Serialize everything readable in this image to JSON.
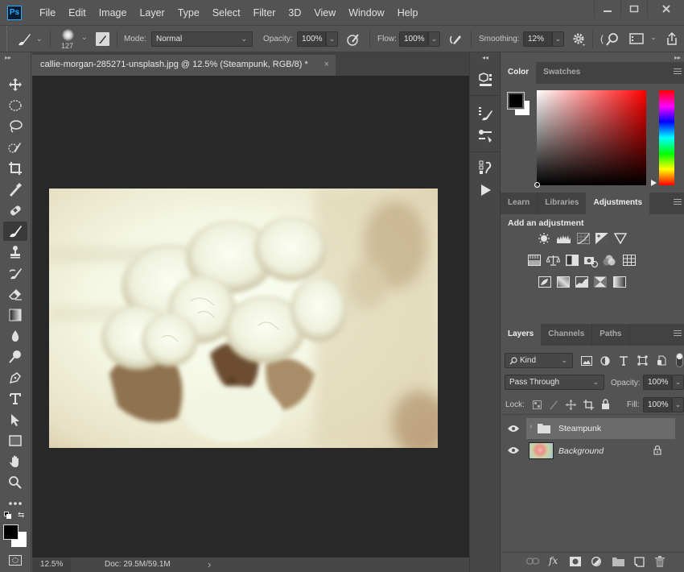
{
  "app": {
    "name": "Adobe Photoshop",
    "logo": "Ps"
  },
  "menu": [
    "File",
    "Edit",
    "Image",
    "Layer",
    "Type",
    "Select",
    "Filter",
    "3D",
    "View",
    "Window",
    "Help"
  ],
  "window_controls": {
    "minimize": "—",
    "maximize": "☐",
    "close": "✕"
  },
  "options": {
    "brush_size": "127",
    "mode_label": "Mode:",
    "mode_value": "Normal",
    "opacity_label": "Opacity:",
    "opacity_value": "100%",
    "flow_label": "Flow:",
    "flow_value": "100%",
    "smoothing_label": "Smoothing:",
    "smoothing_value": "12%"
  },
  "document": {
    "tab_title": "callie-morgan-285271-unsplash.jpg @ 12.5% (Steampunk, RGB/8) *",
    "close": "×",
    "image_description": "Sepia-toned bouquet of roses"
  },
  "status": {
    "zoom": "12.5%",
    "doc": "Doc: 29.5M/59.1M",
    "arrow": "›"
  },
  "tools": [
    "move",
    "marquee",
    "lasso",
    "quick-selection",
    "crop",
    "eyedropper",
    "healing",
    "brush",
    "clone-stamp",
    "history-brush",
    "eraser",
    "gradient",
    "blur",
    "dodge",
    "pen",
    "type",
    "path-selection",
    "rectangle",
    "hand",
    "zoom",
    "more"
  ],
  "color_panel": {
    "tabs": [
      "Color",
      "Swatches"
    ],
    "active_tab": "Color",
    "foreground": "#000000",
    "background": "#ffffff",
    "hue_color": "#ff0000"
  },
  "adjustments_panel": {
    "tabs": [
      "Learn",
      "Libraries",
      "Adjustments"
    ],
    "active_tab": "Adjustments",
    "heading": "Add an adjustment",
    "rows": [
      [
        "brightness-contrast",
        "levels",
        "curves",
        "exposure",
        "vibrance"
      ],
      [
        "hue-saturation",
        "color-balance",
        "black-white",
        "photo-filter",
        "channel-mixer",
        "color-lookup"
      ],
      [
        "invert",
        "posterize",
        "threshold",
        "selective-color",
        "gradient-map"
      ]
    ]
  },
  "layers_panel": {
    "tabs": [
      "Layers",
      "Channels",
      "Paths"
    ],
    "active_tab": "Layers",
    "filter_label": "Kind",
    "blend_mode": "Pass Through",
    "opacity_label": "Opacity:",
    "opacity_value": "100%",
    "lock_label": "Lock:",
    "fill_label": "Fill:",
    "fill_value": "100%",
    "layers": [
      {
        "name": "Steampunk",
        "type": "group",
        "visible": true,
        "selected": true,
        "locked": false
      },
      {
        "name": "Background",
        "type": "image",
        "visible": true,
        "selected": false,
        "locked": true
      }
    ],
    "footer": [
      "link",
      "fx",
      "mask",
      "adjustment",
      "group",
      "new-layer",
      "delete"
    ]
  }
}
